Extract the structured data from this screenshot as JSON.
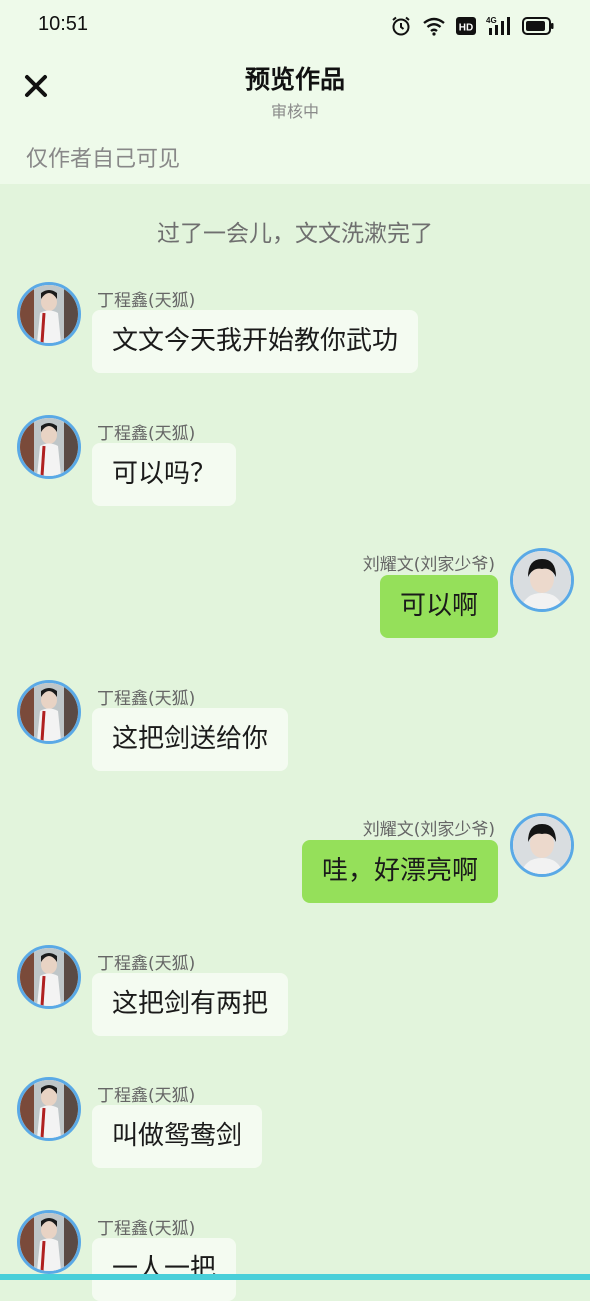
{
  "status_bar": {
    "time": "10:51",
    "icons": [
      "alarm-icon",
      "wifi-icon",
      "hd-icon",
      "signal-4g-icon",
      "battery-icon"
    ],
    "hd_label": "HD",
    "network_label": "4G"
  },
  "header": {
    "close_icon": "close-icon",
    "title": "预览作品",
    "subtitle": "审核中"
  },
  "visibility_notice": "仅作者自己可见",
  "narration": "过了一会儿，文文洗漱完了",
  "messages": [
    {
      "side": "left",
      "sender": "丁程鑫(天狐)",
      "text": "文文今天我开始教你武功"
    },
    {
      "side": "left",
      "sender": "丁程鑫(天狐)",
      "text": "可以吗？"
    },
    {
      "side": "right",
      "sender": "刘耀文(刘家少爷)",
      "text": "可以啊"
    },
    {
      "side": "left",
      "sender": "丁程鑫(天狐)",
      "text": "这把剑送给你"
    },
    {
      "side": "right",
      "sender": "刘耀文(刘家少爷)",
      "text": "哇，好漂亮啊"
    },
    {
      "side": "left",
      "sender": "丁程鑫(天狐)",
      "text": "这把剑有两把"
    },
    {
      "side": "left",
      "sender": "丁程鑫(天狐)",
      "text": "叫做鸳鸯剑"
    },
    {
      "side": "left",
      "sender": "丁程鑫(天狐)",
      "text": "一人一把"
    }
  ],
  "colors": {
    "background": "#e2f4dc",
    "left_bubble": "#f4fbf1",
    "right_bubble": "#95e05a",
    "avatar_border": "#5aa9e6"
  }
}
